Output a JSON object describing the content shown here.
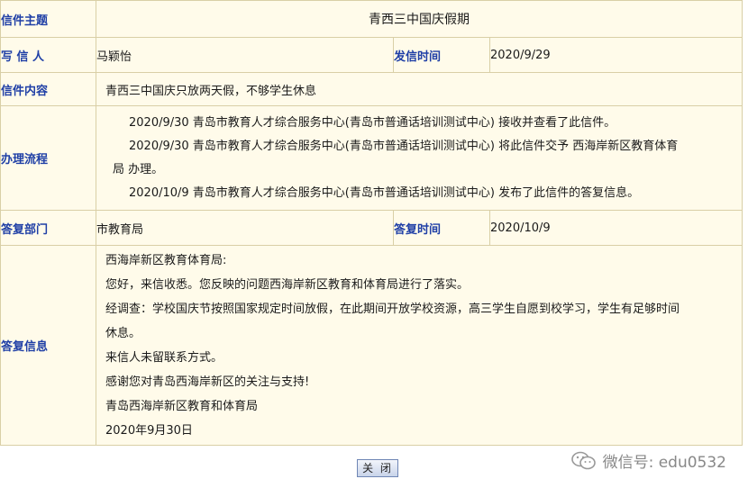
{
  "labels": {
    "subject": "信件主题",
    "writer": "写 信 人",
    "send_time": "发信时间",
    "content": "信件内容",
    "process": "办理流程",
    "reply_dept": "答复部门",
    "reply_time": "答复时间",
    "reply_info": "答复信息"
  },
  "letter": {
    "subject": "青西三中国庆假期",
    "writer": "马颖怡",
    "send_time": "2020/9/29",
    "content": "青西三中国庆只放两天假，不够学生休息"
  },
  "process": [
    {
      "text": "2020/9/30  青岛市教育人才综合服务中心(青岛市普通话培训测试中心) 接收并查看了此信件。"
    },
    {
      "text": "2020/9/30  青岛市教育人才综合服务中心(青岛市普通话培训测试中心) 将此信件交予 西海岸新区教育体育",
      "cont": "局  办理。"
    },
    {
      "text": "2020/10/9  青岛市教育人才综合服务中心(青岛市普通话培训测试中心) 发布了此信件的答复信息。"
    }
  ],
  "reply": {
    "dept": "市教育局",
    "time": "2020/10/9",
    "lines": [
      "西海岸新区教育体育局:",
      "您好，来信收悉。您反映的问题西海岸新区教育和体育局进行了落实。",
      "经调查：学校国庆节按照国家规定时间放假，在此期间开放学校资源，高三学生自愿到校学习，学生有足够时间",
      "休息。",
      "来信人未留联系方式。",
      "感谢您对青岛西海岸新区的关注与支持!",
      "青岛西海岸新区教育和体育局",
      "2020年9月30日"
    ]
  },
  "close_button": "关 闭",
  "watermark": "微信号: edu0532",
  "colors": {
    "label_text": "#1f3fa6",
    "label_bg": "#fbf2cf",
    "cell_bg": "#fffbea",
    "border": "#d9cfa6"
  }
}
